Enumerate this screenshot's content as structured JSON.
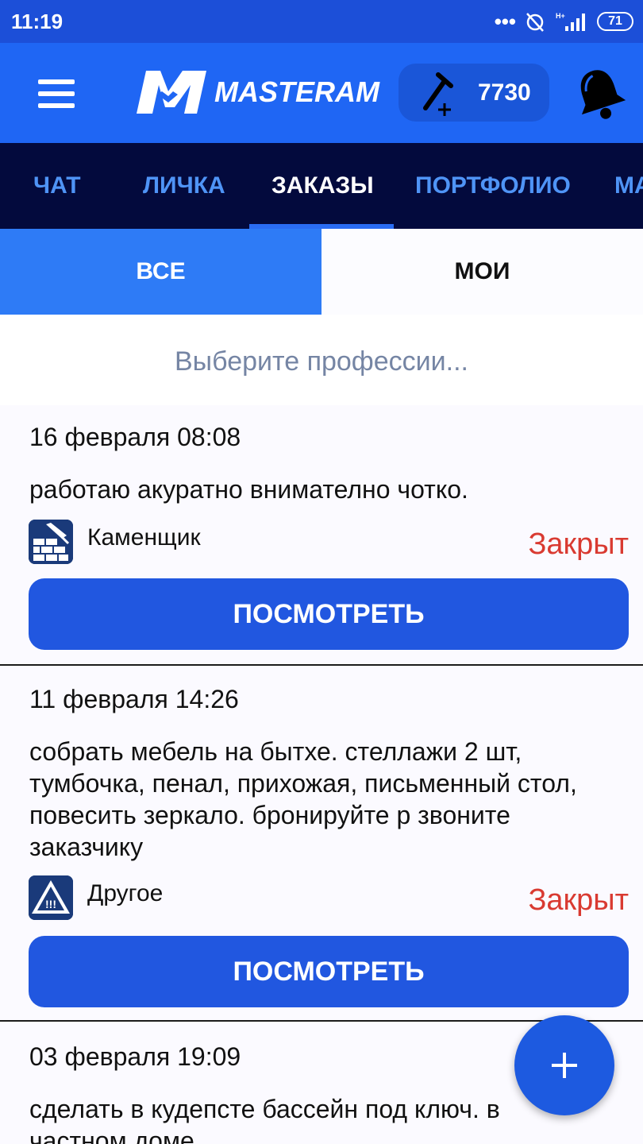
{
  "status_bar": {
    "time": "11:19",
    "battery": "71"
  },
  "header": {
    "logo_text": "MASTERAM",
    "balance": "7730"
  },
  "tabs": [
    {
      "label": "ЧАТ"
    },
    {
      "label": "ЛИЧКА"
    },
    {
      "label": "ЗАКАЗЫ"
    },
    {
      "label": "ПОРТФОЛИО"
    },
    {
      "label": "МА"
    }
  ],
  "segments": {
    "all": "ВСЕ",
    "mine": "МОИ"
  },
  "filter": {
    "placeholder": "Выберите профессии..."
  },
  "orders": [
    {
      "date": "16 февраля 08:08",
      "description": "работаю акуратно внимателно чотко.",
      "profession": "Каменщик",
      "profession_icon": "bricklayer-icon",
      "status": "Закрыт",
      "button": "ПОСМОТРЕТЬ"
    },
    {
      "date": "11 февраля 14:26",
      "description": "собрать мебель на бытхе. стеллажи 2 шт, тумбочка, пенал, прихожая, письменный стол, повесить зеркало. бронируйте р звоните заказчику",
      "profession": "Другое",
      "profession_icon": "warning-icon",
      "status": "Закрыт",
      "button": "ПОСМОТРЕТЬ"
    },
    {
      "date": "03 февраля 19:09",
      "description": "сделать в кудепсте бассейн под ключ. в частном доме"
    }
  ],
  "colors": {
    "status_bar": "#1c4fd8",
    "app_bar": "#1f66f4",
    "tabs_bg": "#030a3d",
    "tab_inactive": "#4f94f6",
    "button": "#2157e0",
    "status_closed": "#d93a31"
  }
}
